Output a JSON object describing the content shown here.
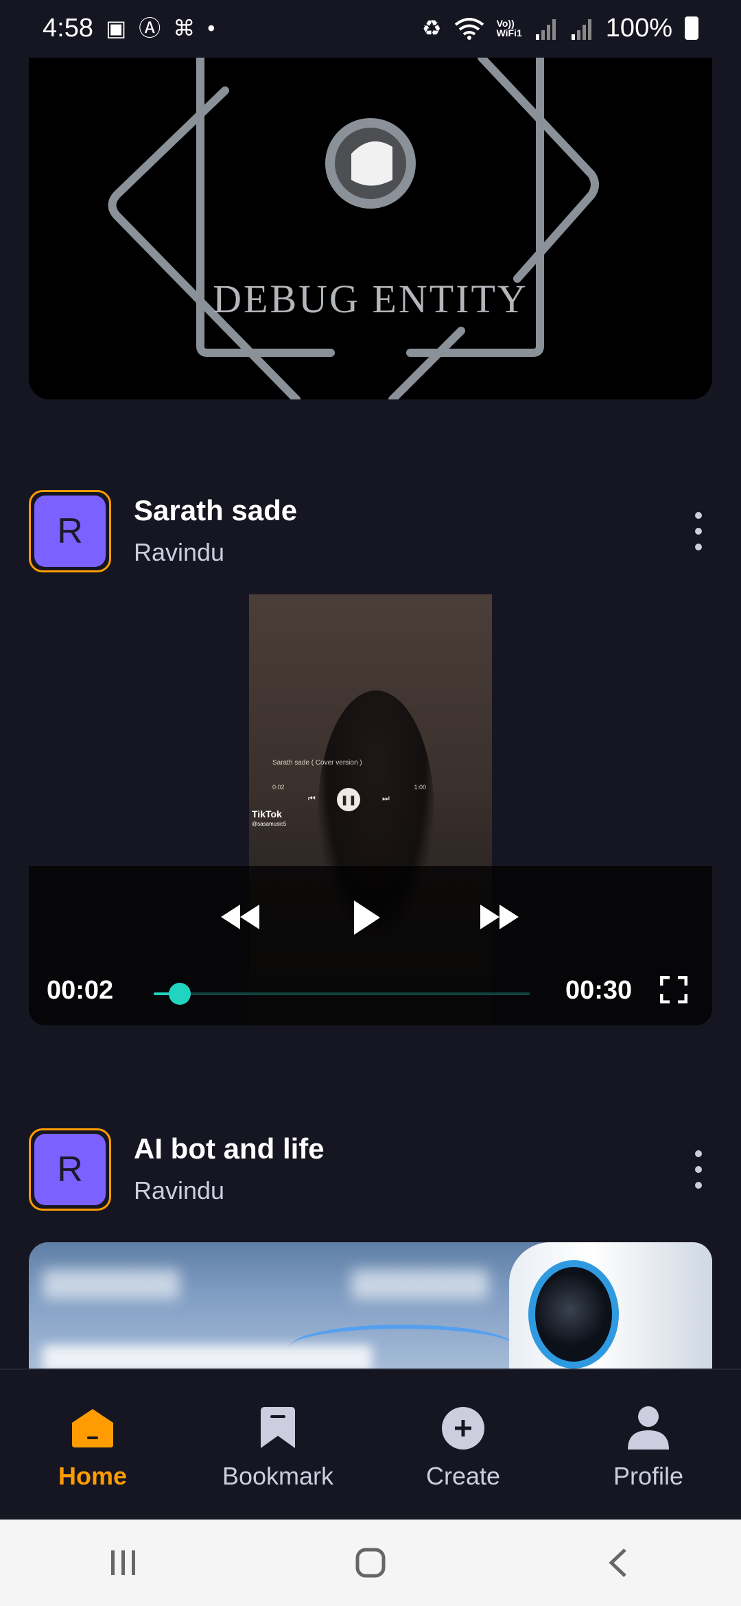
{
  "status_bar": {
    "time": "4:58",
    "battery": "100%",
    "vowifi": "Vo))\nWiFi1"
  },
  "banner": {
    "title": "DEBUG ENTITY",
    "ring_text": "DEBUG ENTITY"
  },
  "posts": [
    {
      "title": "Sarath sade",
      "author": "Ravindu",
      "avatar_letter": "R"
    },
    {
      "title": "AI bot and life",
      "author": "Ravindu",
      "avatar_letter": "R"
    }
  ],
  "video": {
    "overlay_caption": "Sarath sade ( Cover version )",
    "overlay_time_current": "0:02",
    "overlay_time_total": "1:00",
    "tiktok_label": "TikTok",
    "tiktok_handle": "@sasamusic5",
    "current_time": "00:02",
    "duration": "00:30",
    "progress_fraction": 0.07
  },
  "tabs": [
    {
      "label": "Home",
      "icon": "home-icon",
      "active": true
    },
    {
      "label": "Bookmark",
      "icon": "bookmark-icon",
      "active": false
    },
    {
      "label": "Create",
      "icon": "plus-circle-icon",
      "active": false
    },
    {
      "label": "Profile",
      "icon": "person-icon",
      "active": false
    }
  ],
  "colors": {
    "background": "#161622",
    "accent": "#ff9c01",
    "avatar": "#7b61ff",
    "seek": "#20d4c0"
  }
}
